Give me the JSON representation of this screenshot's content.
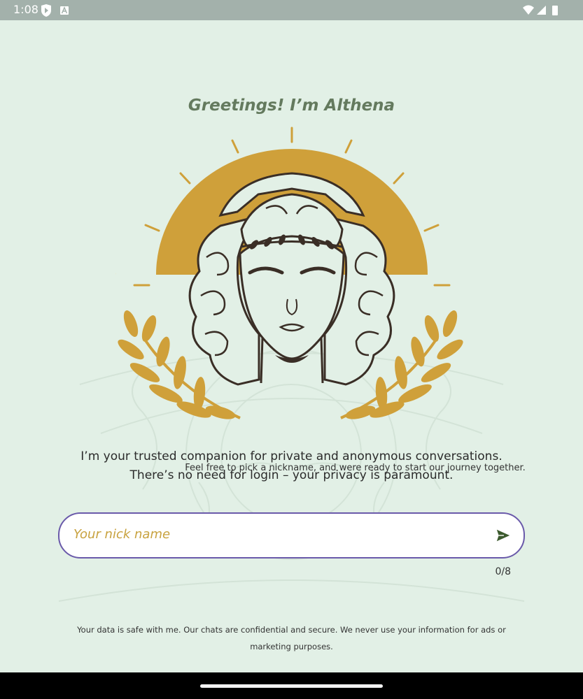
{
  "status_bar": {
    "time": "1:08",
    "icons_left": [
      "shield-play-icon",
      "android-a-icon"
    ],
    "icons_right": [
      "wifi-icon",
      "cell-signal-icon",
      "battery-icon"
    ]
  },
  "greeting": "Greetings! I’m Althena",
  "intro_lines": [
    "I’m your trusted companion for private and anonymous conversations.",
    "There’s no need for login – your privacy is paramount."
  ],
  "nick_hint": "Feel free to pick a nickname, and were ready to start our journey together.",
  "nick_input": {
    "placeholder": "Your nick name",
    "value": "",
    "counter": "0/8"
  },
  "privacy_note": "Your data is safe with me. Our chats are confidential and secure.  We never use your information for ads or marketing purposes.",
  "colors": {
    "background": "#e2f0e6",
    "accent_gold": "#cfa03a",
    "heading_green": "#647a5e",
    "border_purple": "#6a5aaa",
    "line_dark": "#3a2e26"
  }
}
